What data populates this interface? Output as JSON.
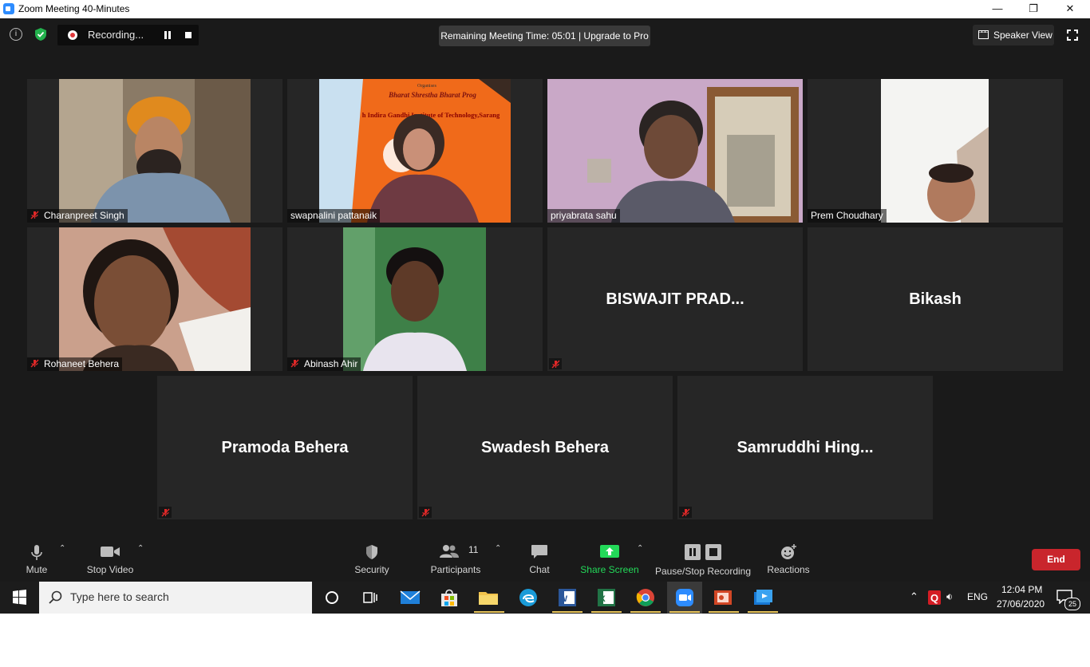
{
  "window": {
    "title": "Zoom Meeting 40-Minutes",
    "minimize_glyph": "—",
    "maximize_glyph": "❐",
    "close_glyph": "✕"
  },
  "top_bar": {
    "recording_label": "Recording...",
    "timer_text": "Remaining Meeting Time: 05:01 | Upgrade to Pro",
    "view_label": "Speaker View"
  },
  "participants": [
    {
      "name": "Charanpreet Singh",
      "muted": true,
      "video": true
    },
    {
      "name": "swapnalini pattanaik",
      "muted": false,
      "video": true
    },
    {
      "name": "priyabrata sahu",
      "muted": false,
      "video": true,
      "active_speaker": true
    },
    {
      "name": "Prem Choudhary",
      "muted": false,
      "video": true
    },
    {
      "name": "Rohaneet Behera",
      "muted": true,
      "video": true
    },
    {
      "name": "Abinash Ahir",
      "muted": true,
      "video": true
    },
    {
      "name": "BISWAJIT  PRAD...",
      "muted": true,
      "video": false
    },
    {
      "name": "Bikash",
      "muted": false,
      "video": false
    },
    {
      "name": "Pramoda Behera",
      "muted": true,
      "video": false
    },
    {
      "name": "Swadesh Behera",
      "muted": true,
      "video": false
    },
    {
      "name": "Samruddhi  Hing...",
      "muted": true,
      "video": false
    }
  ],
  "banner": {
    "organiser": "Organises",
    "programme": "Bharat Shrestha Bharat Prog",
    "institute": "h Indira Gandhi Institute of Technology,Sarang"
  },
  "controls": {
    "mute": "Mute",
    "stop_video": "Stop Video",
    "security": "Security",
    "participants": "Participants",
    "participant_count": "11",
    "chat": "Chat",
    "share_screen": "Share Screen",
    "pause_stop_recording": "Pause/Stop Recording",
    "reactions": "Reactions",
    "end": "End"
  },
  "taskbar": {
    "search_placeholder": "Type here to search",
    "language": "ENG",
    "time": "12:04 PM",
    "date": "27/06/2020",
    "notification_count": "25"
  },
  "colors": {
    "meeting_bg": "#1a1a1a",
    "tile_bg": "#262626",
    "active_speaker_border": "#e6ec46",
    "mute_red": "#e02828",
    "share_green": "#23d959",
    "end_red": "#c9252c"
  }
}
